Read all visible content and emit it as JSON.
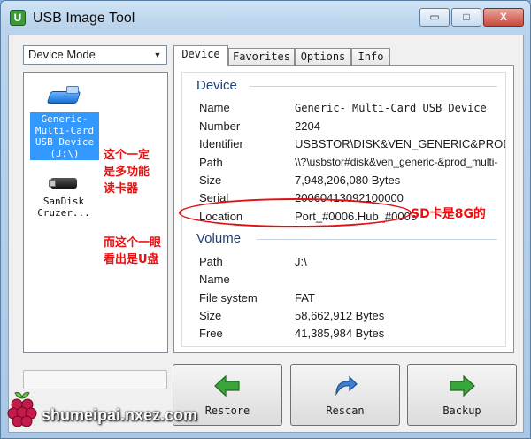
{
  "window": {
    "title": "USB Image Tool",
    "min_glyph": "▭",
    "max_glyph": "□",
    "close_glyph": "X",
    "app_icon_letter": "U"
  },
  "mode_select": {
    "value": "Device Mode"
  },
  "devices": [
    {
      "label": "Generic-Multi-Card USB Device (J:\\)",
      "lines": [
        "Generic-",
        "Multi-Card",
        "USB Device",
        "(J:\\)"
      ],
      "selected": true
    },
    {
      "label": "SanDisk Cruzer...",
      "lines": [
        "SanDisk",
        "Cruzer..."
      ],
      "selected": false
    }
  ],
  "annotations": {
    "card_reader": [
      "这个一定",
      "是多功能",
      "读卡器"
    ],
    "usb_disk": [
      "而这个一眼",
      "看出是U盘"
    ],
    "sd_size": "SD卡是8G的",
    "color": "#e81010"
  },
  "tabs": [
    "Device",
    "Favorites",
    "Options",
    "Info"
  ],
  "device_section": {
    "title": "Device",
    "rows": [
      {
        "label": "Name",
        "value": "Generic- Multi-Card USB Device"
      },
      {
        "label": "Number",
        "value": "2204"
      },
      {
        "label": "Identifier",
        "value": "USBSTOR\\DISK&VEN_GENERIC&PROD"
      },
      {
        "label": "Path",
        "value": "\\\\?\\usbstor#disk&ven_generic-&prod_multi-"
      },
      {
        "label": "Size",
        "value": "7,948,206,080 Bytes"
      },
      {
        "label": "Serial",
        "value": "20060413092100000"
      },
      {
        "label": "Location",
        "value": "Port_#0006.Hub_#0005"
      }
    ]
  },
  "volume_section": {
    "title": "Volume",
    "rows": [
      {
        "label": "Path",
        "value": "J:\\"
      },
      {
        "label": "Name",
        "value": ""
      },
      {
        "label": "File system",
        "value": "FAT"
      },
      {
        "label": "Size",
        "value": "58,662,912 Bytes"
      },
      {
        "label": "Free",
        "value": "41,385,984 Bytes"
      }
    ]
  },
  "progress": {
    "value": 0
  },
  "buttons": {
    "restore": "Restore",
    "rescan": "Rescan",
    "backup": "Backup"
  },
  "watermark": {
    "brand": "shumeipai.nxez.com"
  },
  "colors": {
    "accent_selected": "#3399ff",
    "title_blue": "#1e3f7a",
    "icon_green": "#3aa53a",
    "icon_blue": "#3d7fd0"
  }
}
